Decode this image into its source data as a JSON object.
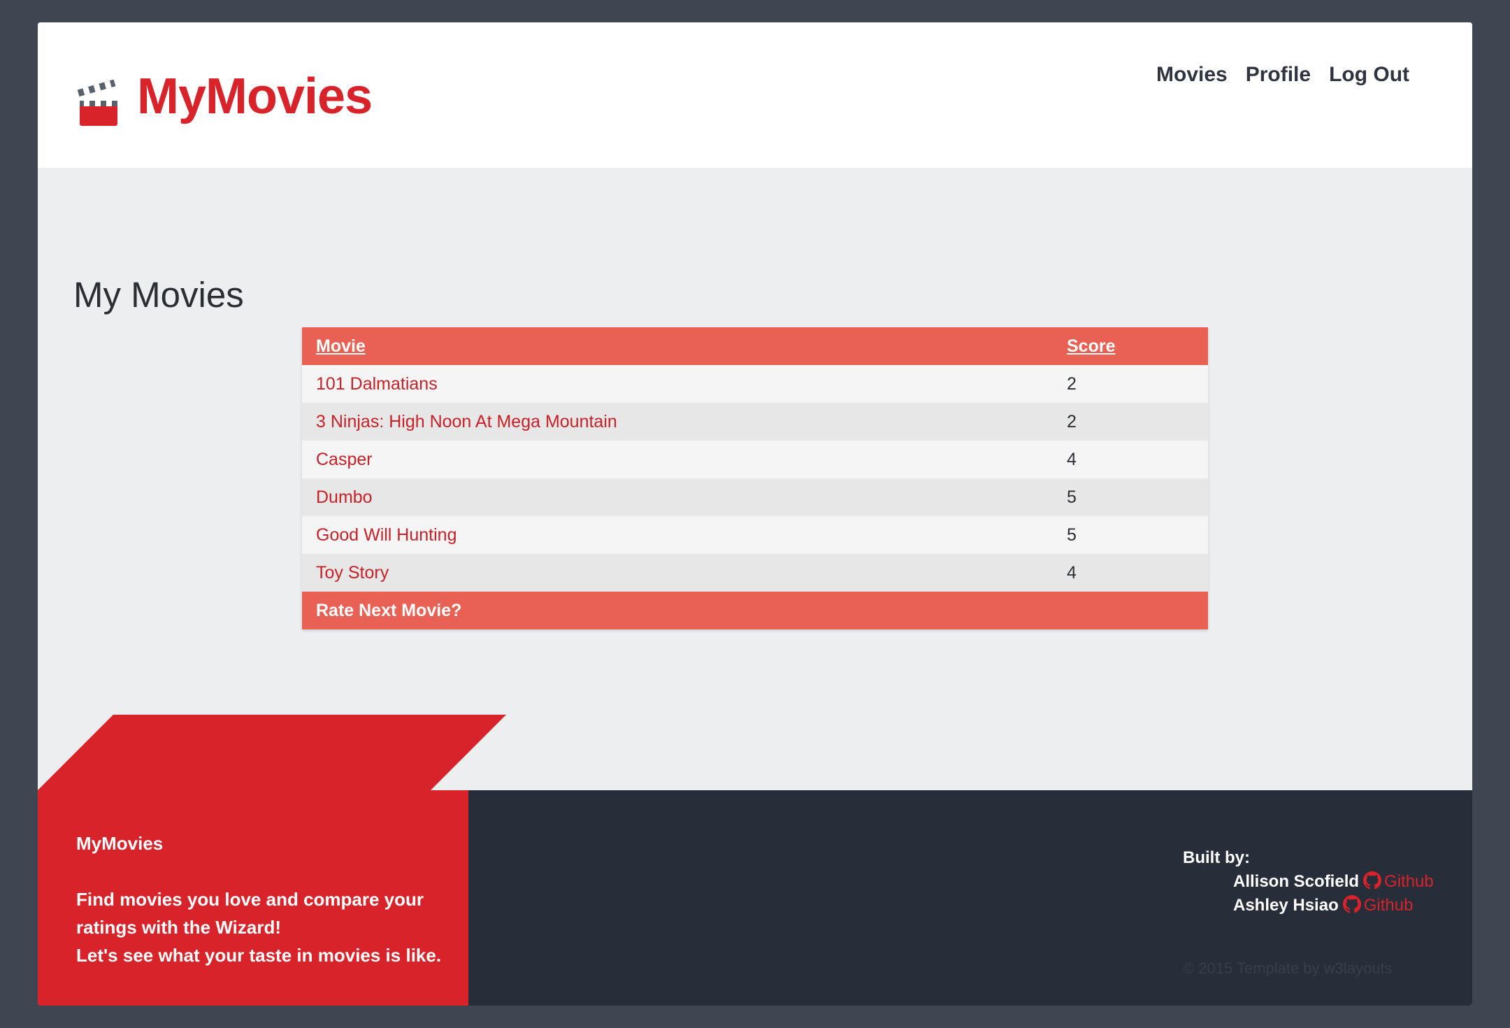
{
  "brand": {
    "name": "MyMovies",
    "icon": "clapperboard-icon"
  },
  "nav": {
    "items": [
      "Movies",
      "Profile",
      "Log Out"
    ]
  },
  "main": {
    "title": "My Movies",
    "table": {
      "headers": {
        "movie": "Movie",
        "score": "Score"
      },
      "rows": [
        {
          "title": "101 Dalmatians",
          "score": "2"
        },
        {
          "title": "3 Ninjas: High Noon At Mega Mountain",
          "score": "2"
        },
        {
          "title": "Casper",
          "score": "4"
        },
        {
          "title": "Dumbo",
          "score": "5"
        },
        {
          "title": "Good Will Hunting",
          "score": "5"
        },
        {
          "title": "Toy Story",
          "score": "4"
        }
      ],
      "footer_action": "Rate Next Movie?"
    }
  },
  "footer": {
    "brand": "MyMovies",
    "tagline_1": "Find movies you love and compare your ratings with the Wizard!",
    "tagline_2": "Let's see what your taste in movies is like.",
    "built_by_label": "Built by:",
    "authors": [
      {
        "name": "Allison Scofield",
        "link": "Github"
      },
      {
        "name": "Ashley Hsiao",
        "link": "Github"
      }
    ],
    "copyright": "© 2015 Template by w3layouts"
  },
  "colors": {
    "accent": "#d8232a",
    "table_header": "#e86154",
    "footer_dark": "#272d39"
  }
}
